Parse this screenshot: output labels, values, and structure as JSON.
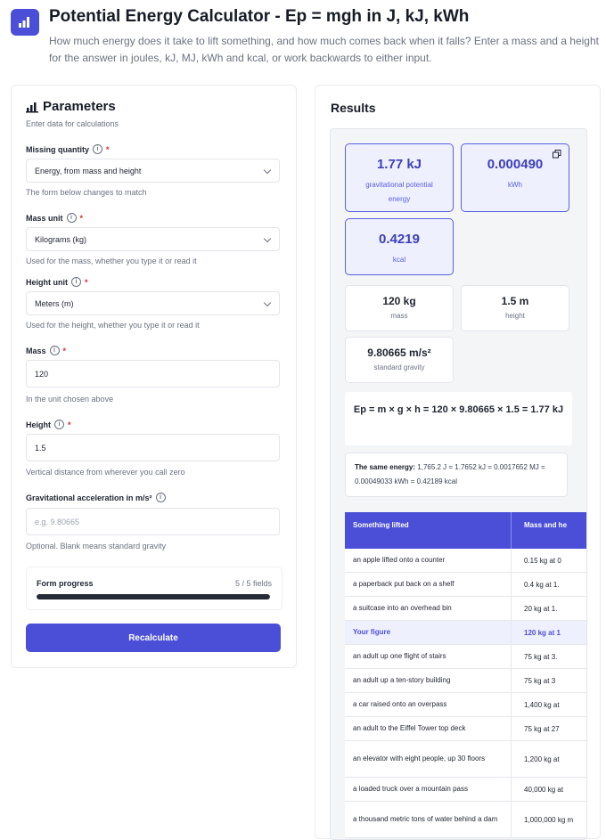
{
  "header": {
    "title": "Potential Energy Calculator - Ep = mgh in J, kJ, kWh",
    "subtitle": "How much energy does it take to lift something, and how much comes back when it falls? Enter a mass and a height for the answer in joules, kJ, MJ, kWh and kcal, or work backwards to either input."
  },
  "parameters": {
    "title": "Parameters",
    "caption": "Enter data for calculations",
    "missing": {
      "label": "Missing quantity",
      "value": "Energy, from mass and height",
      "help": "The form below changes to match"
    },
    "mass_unit": {
      "label": "Mass unit",
      "value": "Kilograms (kg)",
      "help": "Used for the mass, whether you type it or read it"
    },
    "height_unit": {
      "label": "Height unit",
      "value": "Meters (m)",
      "help": "Used for the height, whether you type it or read it"
    },
    "mass": {
      "label": "Mass",
      "value": "120",
      "help": "In the unit chosen above"
    },
    "height": {
      "label": "Height",
      "value": "1.5",
      "help": "Vertical distance from wherever you call zero"
    },
    "gravity": {
      "label": "Gravitational acceleration in m/s²",
      "placeholder": "e.g. 9.80665",
      "help": "Optional. Blank means standard gravity"
    },
    "required_mark": "*",
    "progress": {
      "label": "Form progress",
      "count": "5 / 5 fields",
      "fraction": 1.0
    },
    "recalc_label": "Recalculate"
  },
  "results": {
    "title": "Results",
    "tiles": [
      {
        "value": "1.77 kJ",
        "caption": "gravitational potential energy"
      },
      {
        "value": "0.000490",
        "caption": "kWh"
      },
      {
        "value": "0.4219",
        "caption": "kcal"
      }
    ],
    "inputs": [
      {
        "value": "120 kg",
        "caption": "mass"
      },
      {
        "value": "1.5 m",
        "caption": "height"
      },
      {
        "value": "9.80665 m/s²",
        "caption": "standard gravity"
      }
    ],
    "formula": "Ep = m × g × h = 120 × 9.80665 × 1.5 = 1.77 kJ",
    "same_label": "The same energy:",
    "same_text": "1,765.2 J = 1.7652 kJ = 0.0017652 MJ = 0.00049033 kWh = 0.42189 kcal",
    "table": {
      "headers": [
        "Something lifted",
        "Mass and he"
      ],
      "rows": [
        {
          "thing": "an apple lifted onto a counter",
          "mass": "0.15 kg at 0"
        },
        {
          "thing": "a paperback put back on a shelf",
          "mass": "0.4 kg at 1."
        },
        {
          "thing": "a suitcase into an overhead bin",
          "mass": "20 kg at 1."
        },
        {
          "thing": "Your figure",
          "mass": "120 kg at 1"
        },
        {
          "thing": "an adult up one flight of stairs",
          "mass": "75 kg at 3."
        },
        {
          "thing": "an adult up a ten-story building",
          "mass": "75 kg at 3"
        },
        {
          "thing": "a car raised onto an overpass",
          "mass": "1,400 kg at"
        },
        {
          "thing": "an adult to the Eiffel Tower top deck",
          "mass": "75 kg at 27"
        },
        {
          "thing": "an elevator with eight people, up 30 floors",
          "mass": "1,200 kg at"
        },
        {
          "thing": "a loaded truck over a mountain pass",
          "mass": "40,000 kg at"
        },
        {
          "thing": "a thousand metric tons of water behind a dam",
          "mass": "1,000,000 kg m"
        }
      ]
    }
  },
  "colors": {
    "accent": "#4b4fd8",
    "accent_light": "#eef0fe",
    "text": "#1f2430",
    "muted": "#6b7280"
  }
}
